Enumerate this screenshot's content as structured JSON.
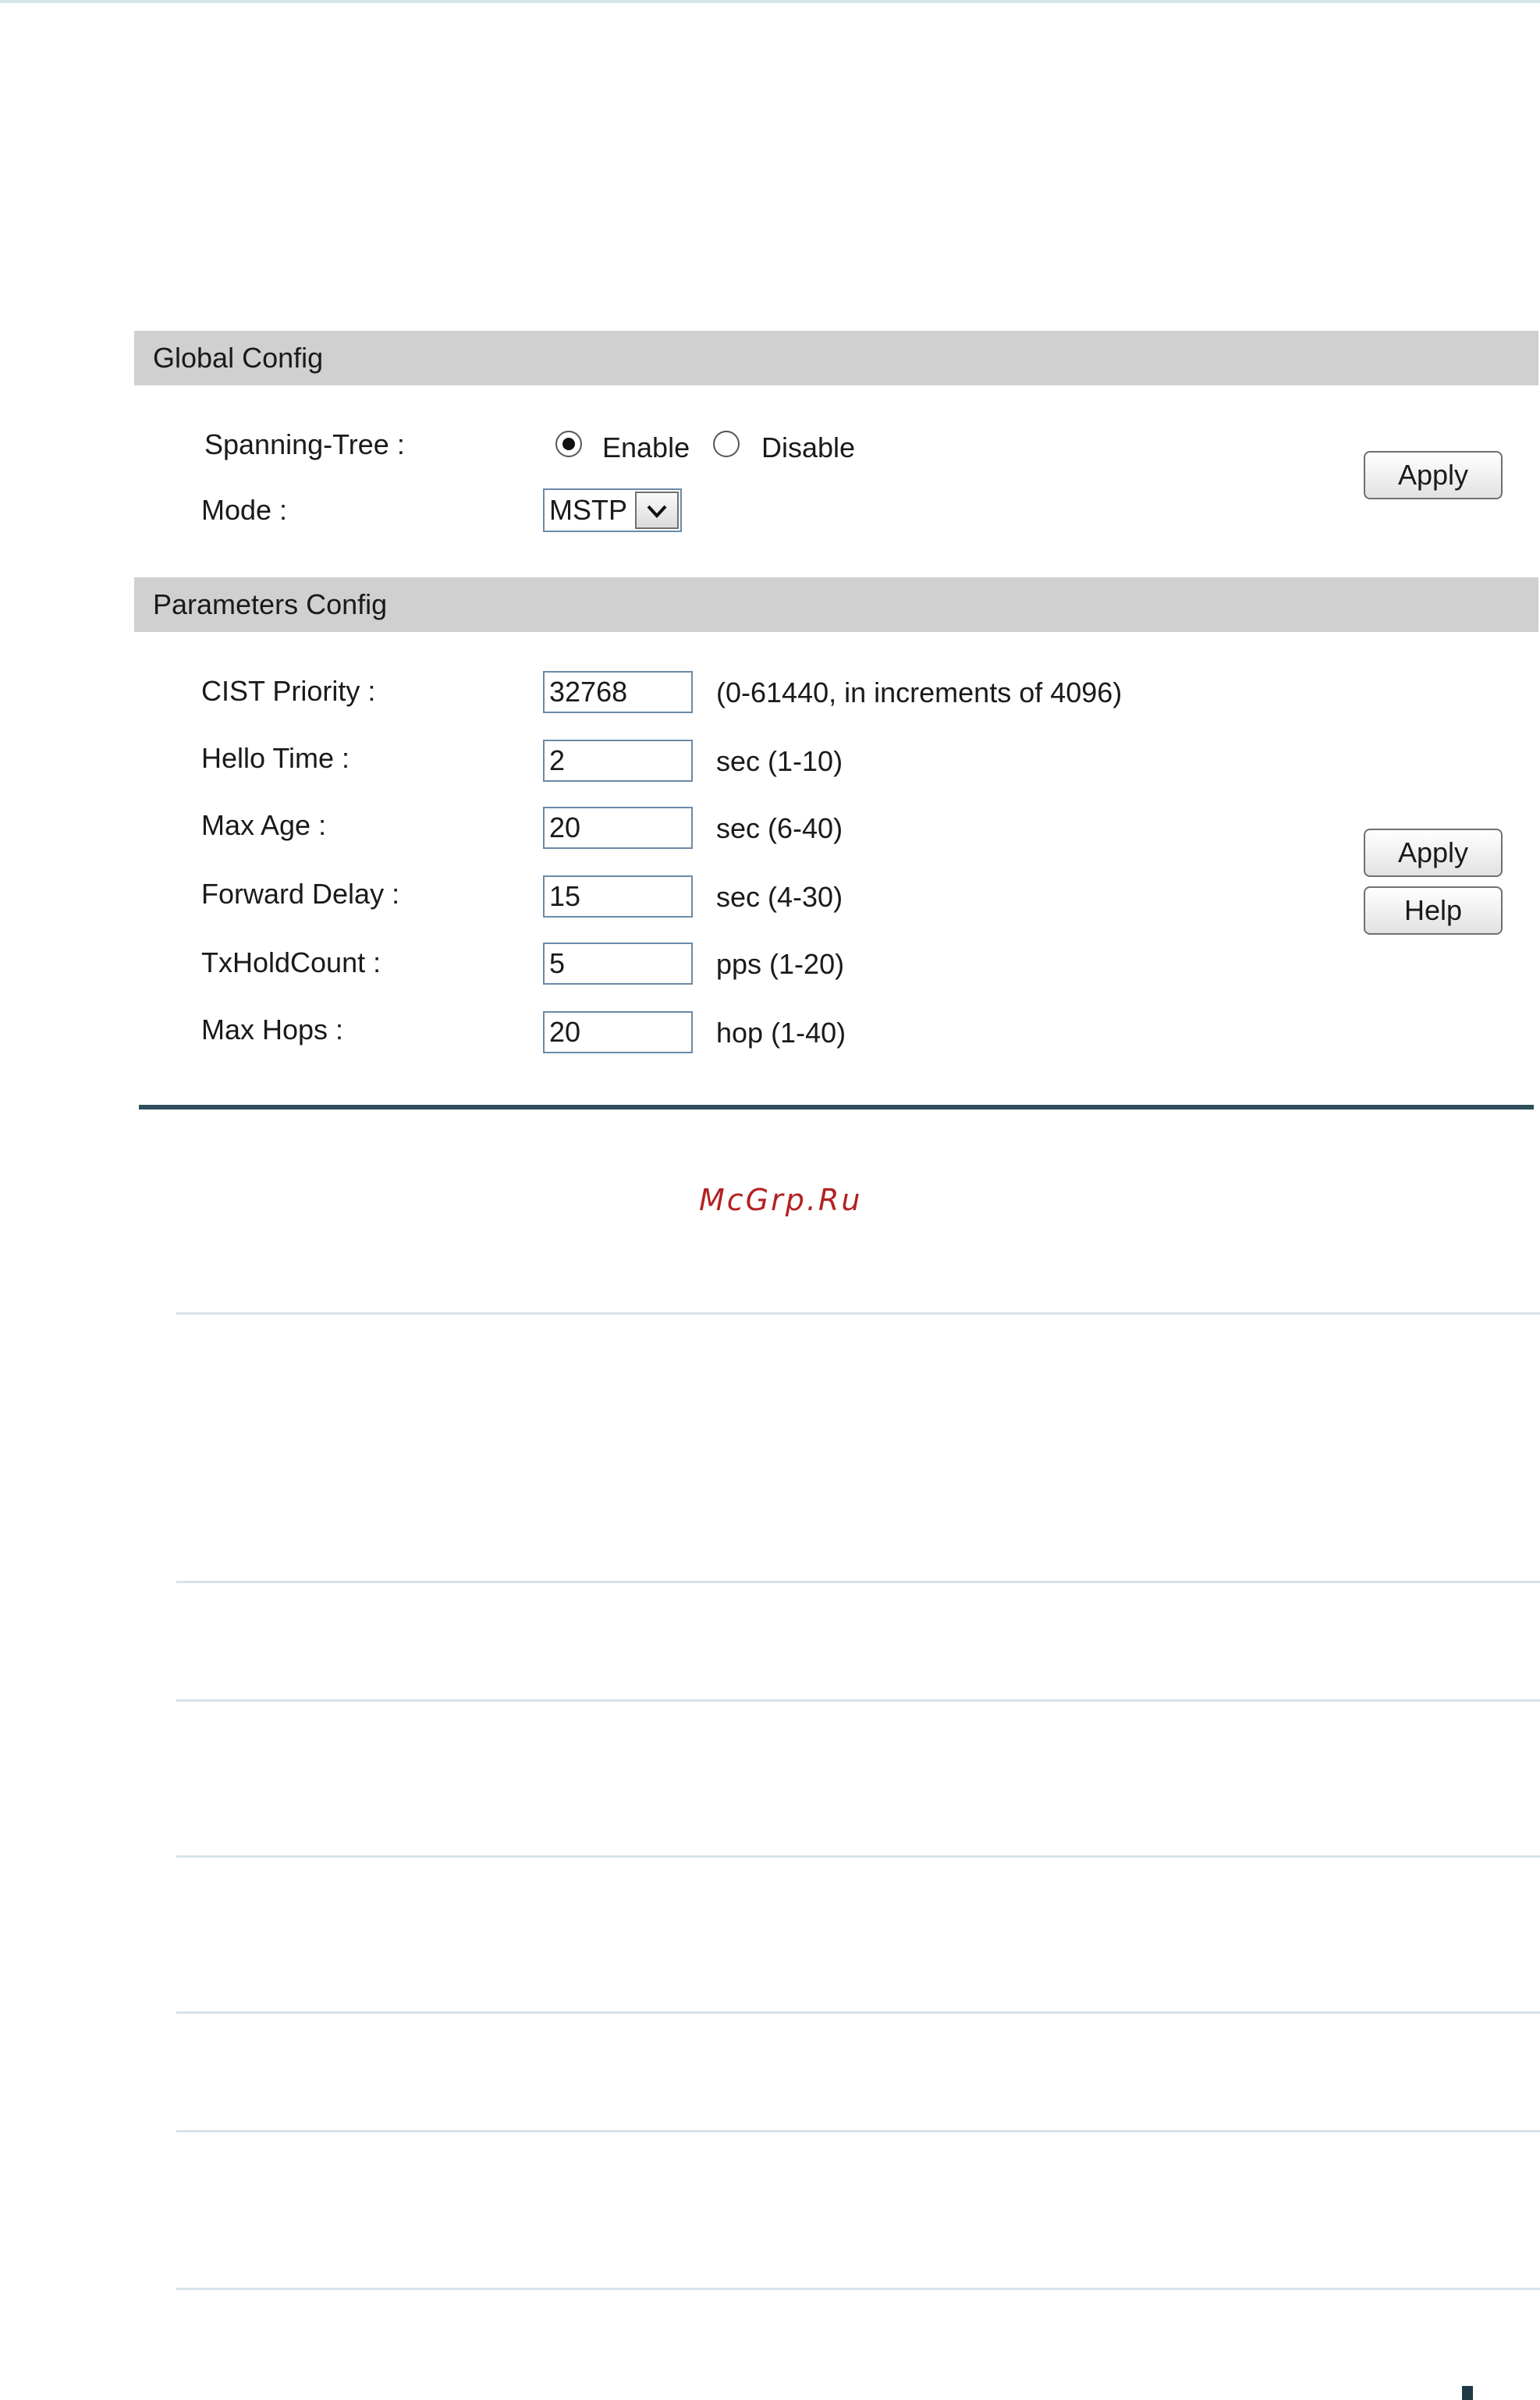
{
  "global_config": {
    "header": "Global Config",
    "spanning_tree_label": "Spanning-Tree :",
    "enable_label": "Enable",
    "disable_label": "Disable",
    "selected": "Enable",
    "mode_label": "Mode :",
    "mode_value": "MSTP",
    "apply_label": "Apply"
  },
  "parameters_config": {
    "header": "Parameters Config",
    "fields": [
      {
        "label": "CIST Priority :",
        "value": "32768",
        "hint": "(0-61440, in increments of 4096)"
      },
      {
        "label": "Hello Time :",
        "value": "2",
        "hint": "sec (1-10)"
      },
      {
        "label": "Max Age :",
        "value": "20",
        "hint": "sec (6-40)"
      },
      {
        "label": "Forward Delay :",
        "value": "15",
        "hint": "sec (4-30)"
      },
      {
        "label": "TxHoldCount :",
        "value": "5",
        "hint": "pps (1-20)"
      },
      {
        "label": "Max Hops :",
        "value": "20",
        "hint": "hop (1-40)"
      }
    ],
    "apply_label": "Apply",
    "help_label": "Help"
  },
  "watermark": "McGrp.Ru",
  "icons": {
    "radio_checked": "radio-checked-icon",
    "radio_unchecked": "radio-unchecked-icon",
    "select_arrow": "chevron-down-icon"
  },
  "colors": {
    "section_header_bg": "#d0d0d0",
    "input_border": "#6a8aa8",
    "bottom_bar": "#2f4f5c",
    "watermark": "#b22222",
    "separator": "#d6e4ea"
  }
}
